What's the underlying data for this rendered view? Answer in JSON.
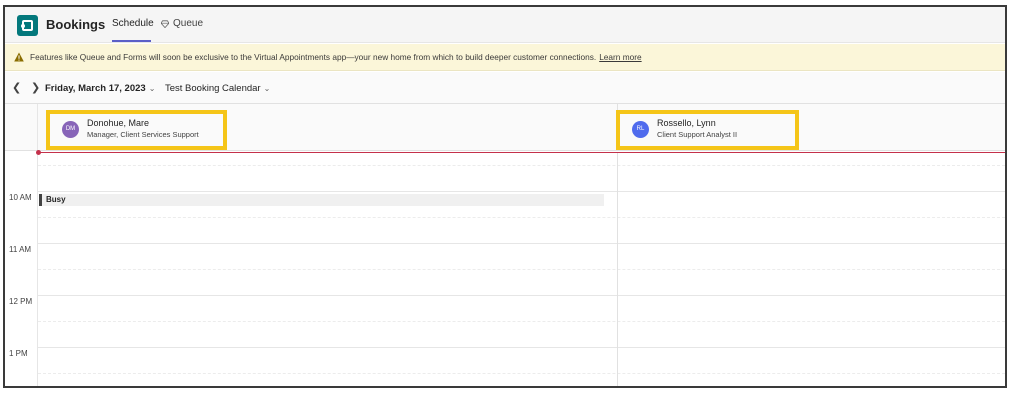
{
  "app": {
    "title": "Bookings",
    "logo_icon": "bookings-app-icon",
    "accent": "#5b5fc7"
  },
  "tabs": [
    {
      "label": "Schedule",
      "active": true
    },
    {
      "label": "Queue",
      "icon": "gem-icon",
      "active": false
    }
  ],
  "banner": {
    "icon": "warning-icon",
    "text": "Features like Queue and Forms will soon be exclusive to the Virtual Appointments app—your new home from which to build deeper customer connections.",
    "link": "Learn more",
    "background": "#fbf6d9"
  },
  "datebar": {
    "prev_icon": "chevron-left-icon",
    "next_icon": "chevron-right-icon",
    "date": "Friday, March 17, 2023",
    "calendar": "Test Booking Calendar"
  },
  "staff": [
    {
      "initials": "DM",
      "name": "Donohue, Mare",
      "role": "Manager, Client Services Support",
      "avatar_color": "#8764b8"
    },
    {
      "initials": "RL",
      "name": "Rossello, Lynn",
      "role": "Client Support Analyst II",
      "avatar_color": "#4f6bed"
    }
  ],
  "highlight_color": "#f5c518",
  "time_labels": [
    "10 AM",
    "11 AM",
    "12 PM",
    "1 PM"
  ],
  "events": [
    {
      "label": "Busy",
      "staff": "Donohue, Mare"
    }
  ],
  "now_indicator_color": "#c4314b"
}
